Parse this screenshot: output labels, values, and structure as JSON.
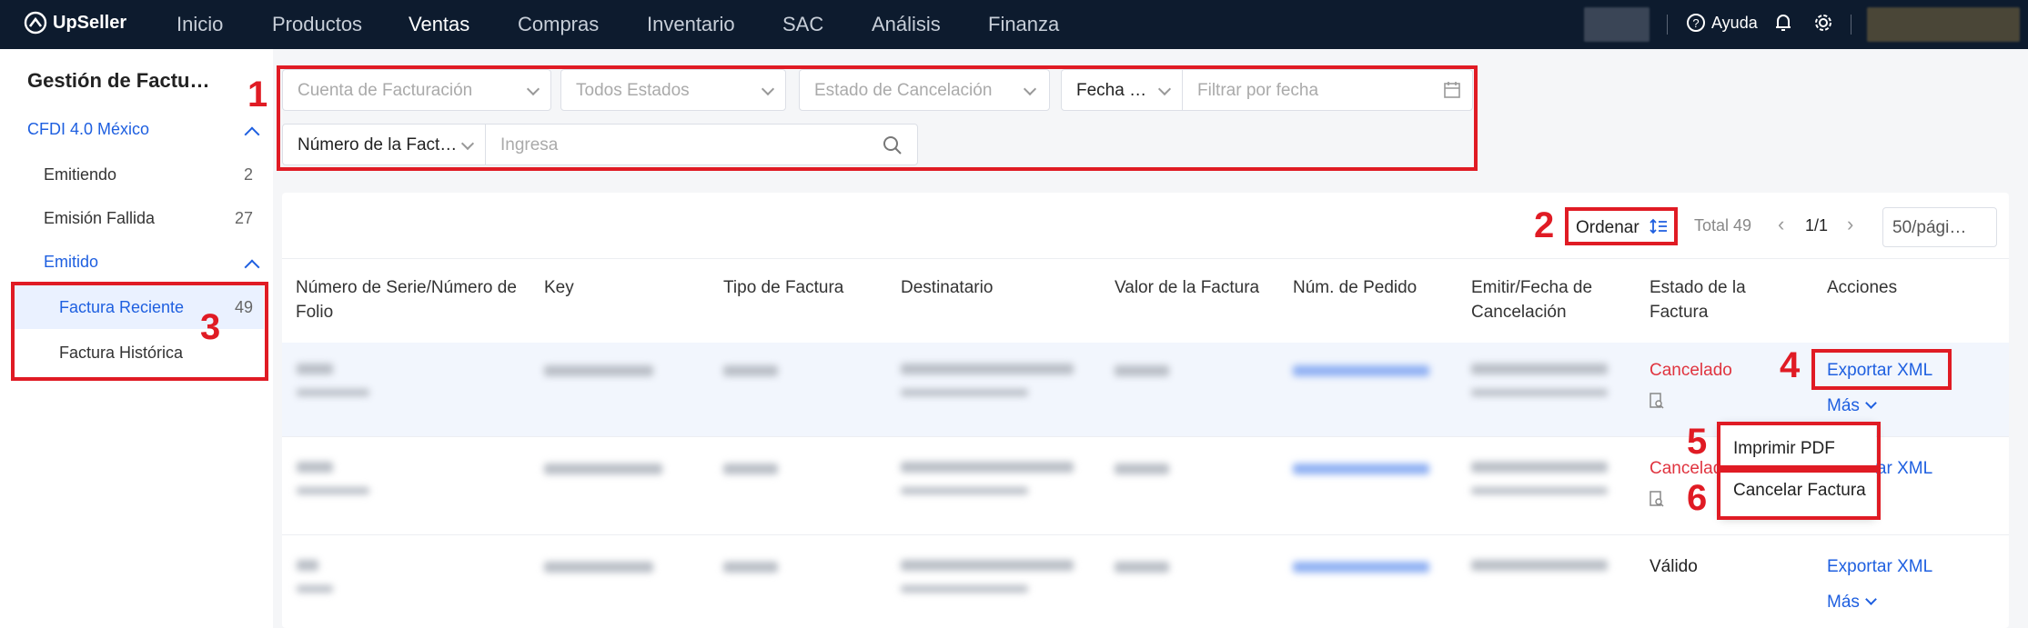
{
  "nav": {
    "brand": "UpSeller",
    "items": [
      "Inicio",
      "Productos",
      "Ventas",
      "Compras",
      "Inventario",
      "SAC",
      "Análisis",
      "Finanza"
    ],
    "active": "Ventas",
    "help": "Ayuda"
  },
  "sidebar": {
    "title": "Gestión de Factu…",
    "group": "CFDI 4.0 México",
    "items": [
      {
        "label": "Emitiendo",
        "count": "2"
      },
      {
        "label": "Emisión Fallida",
        "count": "27"
      },
      {
        "label": "Emitido",
        "count": ""
      }
    ],
    "sub_items": [
      {
        "label": "Factura Reciente",
        "count": "49"
      },
      {
        "label": "Factura Histórica",
        "count": ""
      }
    ]
  },
  "filters": {
    "billing_account": "Cuenta de Facturación",
    "all_states": "Todos Estados",
    "cancel_state": "Estado de Cancelación",
    "date_type": "Fecha …",
    "date_placeholder": "Filtrar por fecha",
    "invoice_number": "Número de la Fact…",
    "search_placeholder": "Ingresa"
  },
  "toolbar": {
    "sort": "Ordenar",
    "total": "Total 49",
    "page": "1/1",
    "page_size": "50/pági…"
  },
  "table": {
    "headers": [
      "Número de Serie/Número de Folio",
      "Key",
      "Tipo de Factura",
      "Destinatario",
      "Valor de la Factura",
      "Núm. de Pedido",
      "Emitir/Fecha de Cancelación",
      "Estado de la Factura",
      "Acciones"
    ],
    "rows": [
      {
        "status": "Cancelado",
        "action": "Exportar XML",
        "more": "Más"
      },
      {
        "status": "Cancelado",
        "action": "Exportar XML",
        "more": ""
      },
      {
        "status": "Válido",
        "action": "Exportar XML",
        "more": "Más"
      }
    ]
  },
  "dropdown": {
    "print_pdf": "Imprimir PDF",
    "cancel_invoice": "Cancelar Factura"
  },
  "annotations": [
    "1",
    "2",
    "3",
    "4",
    "5",
    "6"
  ],
  "colors": {
    "annotation": "#e01b24",
    "link": "#1e5fe0",
    "cancelled": "#e0343f",
    "nav_bg": "#0d1b2e"
  }
}
